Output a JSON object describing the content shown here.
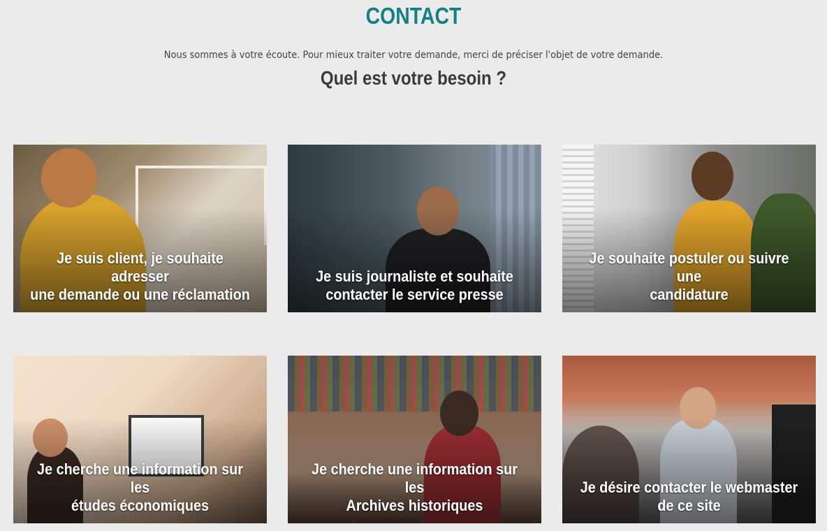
{
  "header": {
    "title": "CONTACT",
    "intro": "Nous sommes à votre écoute. Pour mieux traiter votre demande, merci de préciser l'objet de votre demande.",
    "question": "Quel est votre besoin ?"
  },
  "cards": [
    {
      "line1": "Je suis client, je souhaite adresser",
      "line2": "une demande ou une réclamation"
    },
    {
      "line1": "Je suis journaliste et souhaite",
      "line2": "contacter le service presse"
    },
    {
      "line1": "Je souhaite postuler ou suivre une",
      "line2": "candidature"
    },
    {
      "line1": "Je cherche une information sur les",
      "line2": "études économiques"
    },
    {
      "line1": "Je cherche une information sur les",
      "line2": "Archives historiques"
    },
    {
      "line1": "Je désire contacter le webmaster",
      "line2": "de ce site"
    }
  ],
  "colors": {
    "accent": "#157f86",
    "background": "#ebebeb",
    "heading": "#3a3a3a"
  }
}
